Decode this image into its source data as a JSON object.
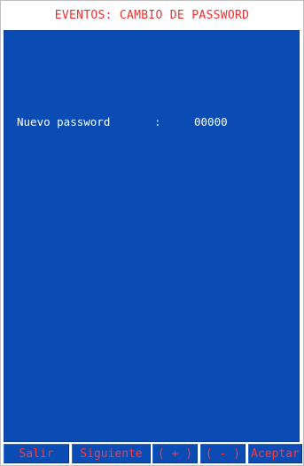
{
  "window": {
    "title": "EVENTOS: CAMBIO DE PASSWORD"
  },
  "form": {
    "field_label": "Nuevo password",
    "separator": ":",
    "field_value": "00000"
  },
  "softkeys": [
    {
      "label": "Salir"
    },
    {
      "label": "Siguiente"
    },
    {
      "label": "( + )"
    },
    {
      "label": "( - )"
    },
    {
      "label": "Aceptar"
    }
  ],
  "colors": {
    "title_text": "#ef2f2f",
    "screen_background": "#0a4cb3",
    "field_text": "#ffffff",
    "softkey_text": "#ff3b3b"
  }
}
